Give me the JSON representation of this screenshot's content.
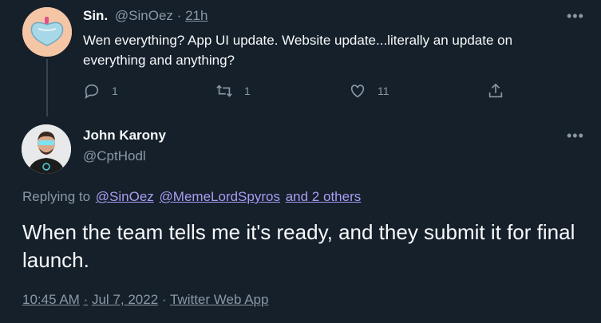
{
  "parent_tweet": {
    "name": "Sin.",
    "handle": "@SinOez",
    "separator": "·",
    "time": "21h",
    "text": "Wen everything? App UI update. Website update...literally an update on everything and anything?",
    "more": "•••",
    "actions": {
      "reply_count": "1",
      "retweet_count": "1",
      "like_count": "11"
    }
  },
  "main_tweet": {
    "name": "John Karony",
    "handle": "@CptHodl",
    "more": "•••",
    "replying_prefix": "Replying to",
    "replying_to": [
      "@SinOez",
      "@MemeLordSpyros",
      "and 2 others"
    ],
    "text": "When the team tells me it's ready, and they submit it for final launch.",
    "time": "10:45 AM",
    "dot": "·",
    "date": "Jul 7, 2022",
    "source": "Twitter Web App"
  },
  "colors": {
    "background": "#15202b",
    "text": "#f7f9f9",
    "muted": "#8b98a5",
    "link": "#a99cf0",
    "thread_line": "#38444d"
  },
  "icons": [
    "reply-icon",
    "retweet-icon",
    "like-icon",
    "share-icon",
    "more-icon"
  ]
}
